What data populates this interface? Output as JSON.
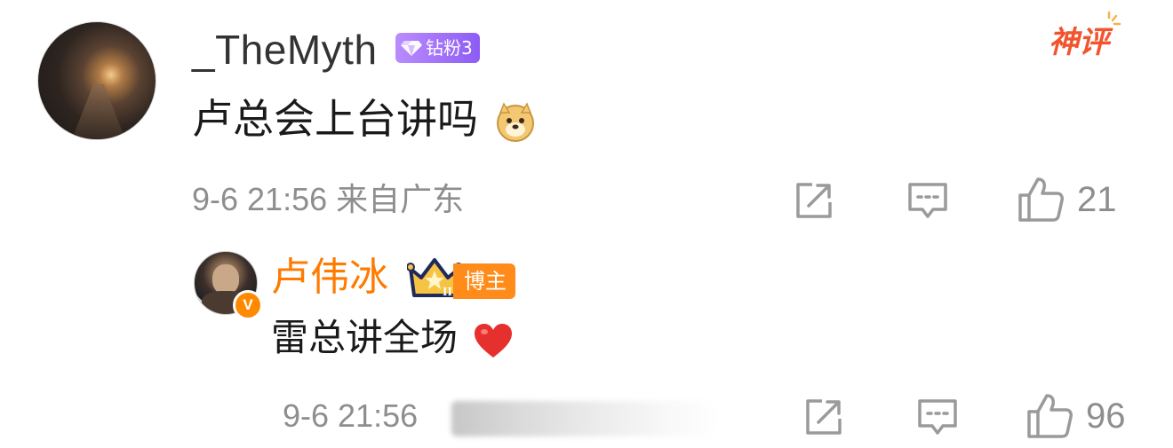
{
  "main_comment": {
    "username": "_TheMyth",
    "fan_badge": "钻粉3",
    "shenping_label": "神评",
    "text": "卢总会上台讲吗",
    "timestamp": "9-6 21:56",
    "location": "来自广东",
    "like_count": "21"
  },
  "reply": {
    "username": "卢伟冰",
    "verified_mark": "V",
    "level_mark": "II",
    "blogger_badge": "博主",
    "text": "雷总讲全场",
    "timestamp": "9-6 21:56",
    "like_count": "96"
  },
  "colors": {
    "accent_orange": "#ff7a00",
    "shenping_red": "#f2542d",
    "fan_badge_purple": "#8d5cf5",
    "meta_gray": "#8e8e8e"
  },
  "icons": [
    "share-icon",
    "comment-icon",
    "like-icon",
    "doge-emoji-icon",
    "heart-emoji-icon",
    "crown-icon",
    "diamond-icon"
  ]
}
